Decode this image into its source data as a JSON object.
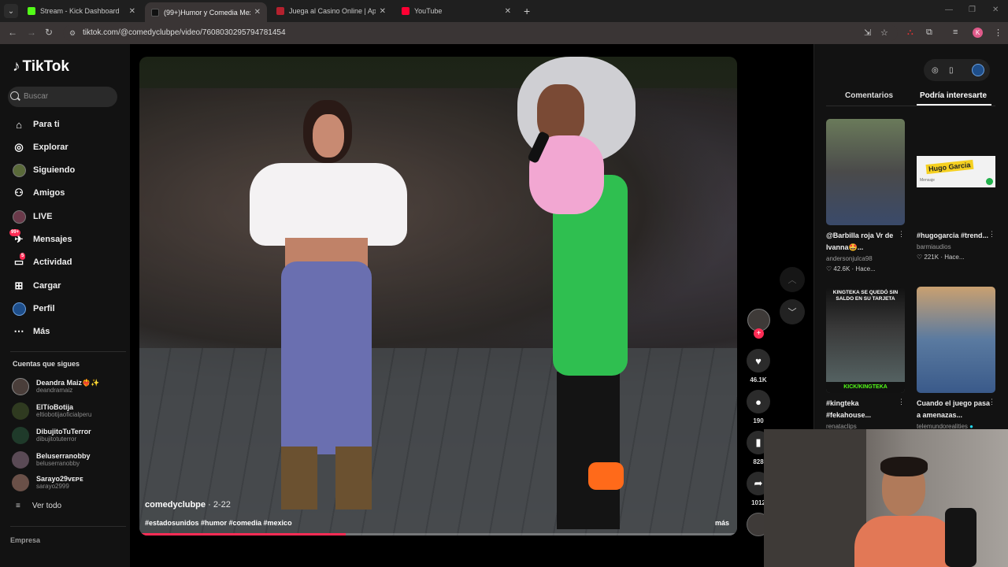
{
  "browser": {
    "tabs": [
      {
        "label": "Stream - Kick Dashboard",
        "color": "#53fc18"
      },
      {
        "label": "(99+)Humor y Comedia Mexicana",
        "color": "#111111"
      },
      {
        "label": "Juega al Casino Online | Apuestas",
        "color": "#b4212e"
      },
      {
        "label": "YouTube",
        "color": "#ff0033"
      }
    ],
    "url": "tiktok.com/@comedyclubpe/video/7608030295794781454",
    "ext_badge": "26",
    "profile_initial": "K"
  },
  "sidebar": {
    "logo": "TikTok",
    "search_placeholder": "Buscar",
    "nav": [
      {
        "label": "Para ti",
        "icon": "home-icon"
      },
      {
        "label": "Explorar",
        "icon": "compass-icon"
      },
      {
        "label": "Siguiendo",
        "icon": "following-avatar-icon"
      },
      {
        "label": "Amigos",
        "icon": "friends-icon"
      },
      {
        "label": "LIVE",
        "icon": "live-icon"
      },
      {
        "label": "Mensajes",
        "icon": "messages-icon",
        "badge": "99+"
      },
      {
        "label": "Actividad",
        "icon": "activity-icon",
        "badge": "5"
      },
      {
        "label": "Cargar",
        "icon": "upload-icon"
      },
      {
        "label": "Perfil",
        "icon": "profile-icon"
      },
      {
        "label": "Más",
        "icon": "more-icon"
      }
    ],
    "following_title": "Cuentas que sigues",
    "following": [
      {
        "name": "Deandra Maiz❤️‍🔥✨",
        "handle": "deandramaiz"
      },
      {
        "name": "ElTíoBotija",
        "handle": "eltiobotijaoficialperu"
      },
      {
        "name": "DibujitoTuTerror",
        "handle": "dibujitotuterror"
      },
      {
        "name": "Beluserranobby",
        "handle": "beluserranobby"
      },
      {
        "name": "Sarayo29ᴠᴇᴘᴇ",
        "handle": "sarayo2999"
      }
    ],
    "see_all": "Ver todo",
    "footer": "Empresa"
  },
  "video": {
    "author": "comedyclubpe",
    "date": "· 2-22",
    "tags": "#estadosunidos #humor #comedia #mexico",
    "more": "más",
    "progress": 0.345
  },
  "actions": {
    "likes": "46.1K",
    "comments": "190",
    "saves": "828",
    "shares": "1012"
  },
  "right_panel": {
    "tab_comments": "Comentarios",
    "tab_interest": "Podría interesarte",
    "cards": [
      {
        "title": "@Barbilla roja Vr de Ivanna🤩...",
        "author": "andersonjulca98",
        "likes": "42.6K",
        "time": "Hace..."
      },
      {
        "title": "#hugogarcia #trend...",
        "author": "barmiaudios",
        "likes": "221K",
        "time": "Hace...",
        "thumb_text": "Hugo Garcia",
        "thumb_sub": "Mensaje"
      },
      {
        "title": "#kingteka #fekahouse...",
        "author": "renataclips",
        "thumb_text": "KINGTEKA SE QUEDÓ SIN SALDO EN SU TARJETA",
        "thumb_sub": "KICK/KINGTEKA"
      },
      {
        "title": "Cuando el juego pasa a amenazas...",
        "author": "telemundorealities"
      }
    ]
  }
}
